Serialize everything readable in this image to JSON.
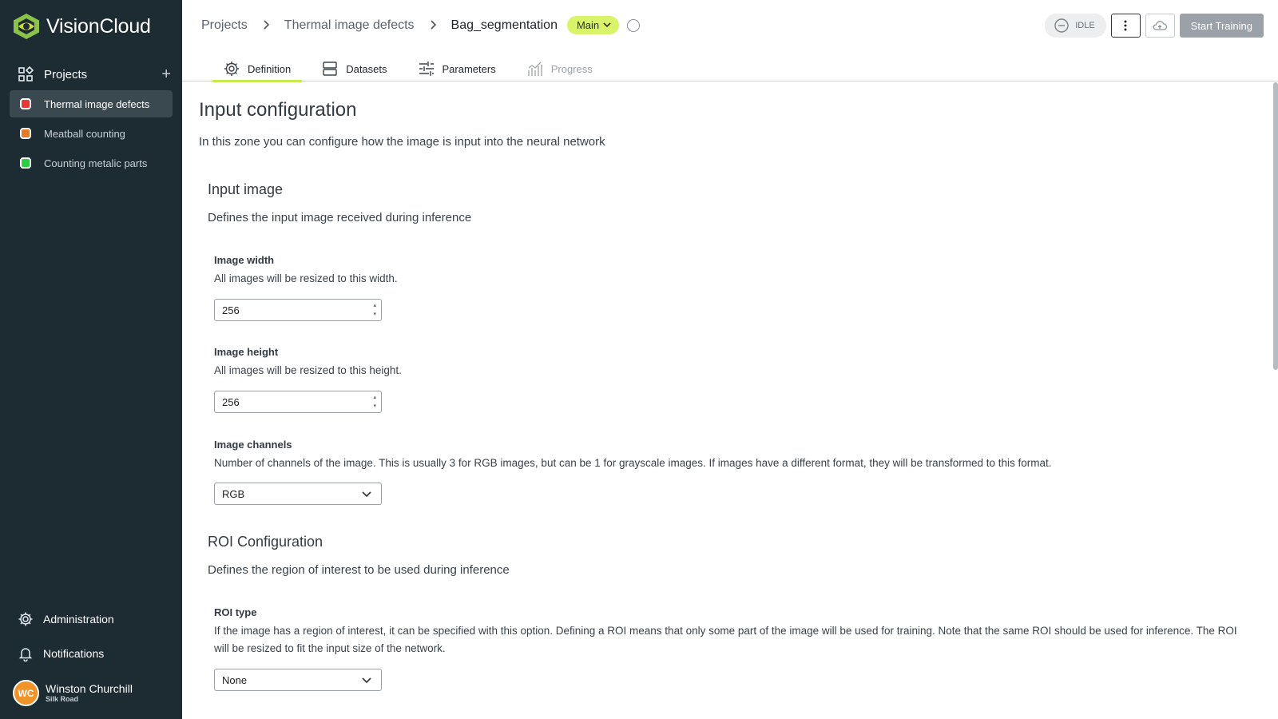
{
  "app": {
    "name": "VisionCloud"
  },
  "sidebar": {
    "projects_label": "Projects",
    "add_label": "+",
    "items": [
      {
        "label": "Thermal image defects",
        "color": "#e53935",
        "active": true
      },
      {
        "label": "Meatball counting",
        "color": "#e07b2c",
        "active": false
      },
      {
        "label": "Counting metalic parts",
        "color": "#2ecc40",
        "active": false
      }
    ],
    "administration": "Administration",
    "notifications": "Notifications",
    "user": {
      "initials": "WC",
      "name": "Winston Churchill",
      "org": "Silk Road"
    }
  },
  "header": {
    "breadcrumb": [
      "Projects",
      "Thermal image defects",
      "Bag_segmentation"
    ],
    "branch": "Main",
    "status": "IDLE",
    "start_training": "Start Training",
    "tabs": [
      {
        "label": "Definition",
        "icon": "gear-icon",
        "active": true
      },
      {
        "label": "Datasets",
        "icon": "database-icon",
        "active": false
      },
      {
        "label": "Parameters",
        "icon": "sliders-icon",
        "active": false
      },
      {
        "label": "Progress",
        "icon": "chart-icon",
        "active": false,
        "disabled": true
      }
    ]
  },
  "content": {
    "title": "Input configuration",
    "description": "In this zone you can configure how the image is input into the neural network",
    "input_image": {
      "title": "Input image",
      "description": "Defines the input image received during inference",
      "width": {
        "label": "Image width",
        "help": "All images will be resized to this width.",
        "value": "256"
      },
      "height": {
        "label": "Image height",
        "help": "All images will be resized to this height.",
        "value": "256"
      },
      "channels": {
        "label": "Image channels",
        "help": "Number of channels of the image. This is usually 3 for RGB images, but can be 1 for grayscale images. If images have a different format, they will be transformed to this format.",
        "value": "RGB"
      }
    },
    "roi": {
      "title": "ROI Configuration",
      "description": "Defines the region of interest to be used during inference",
      "type": {
        "label": "ROI type",
        "help": "If the image has a region of interest, it can be specified with this option. Defining a ROI means that only some part of the image will be used for training. Note that the same ROI should be used for inference. The ROI will be resized to fit the input size of the network.",
        "value": "None"
      }
    }
  },
  "colors": {
    "sidebar_bg": "#1d2b33",
    "accent": "#c7ea4f",
    "branch_bg": "#d9f36b",
    "avatar": "#f0932b"
  }
}
